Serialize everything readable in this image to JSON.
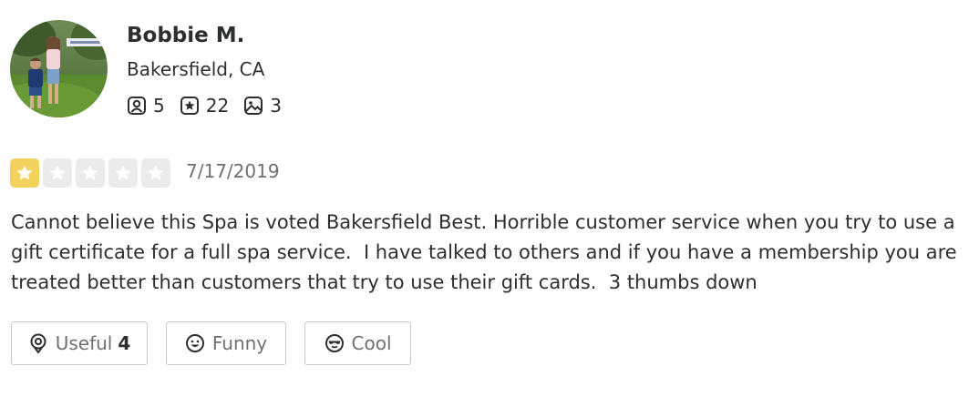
{
  "user": {
    "name": "Bobbie M.",
    "location": "Bakersfield, CA",
    "avatar_icon": "profile-photo",
    "stats": {
      "friends": "5",
      "reviews": "22",
      "photos": "3"
    }
  },
  "review": {
    "rating": 1,
    "rating_max": 5,
    "date": "7/17/2019",
    "text": "Cannot believe this Spa is voted Bakersfield Best. Horrible customer service when you try to use a gift certificate for a full spa service.  I have talked to others and if you have a membership you are treated better than customers that try to use their gift cards.  3 thumbs down"
  },
  "reactions": {
    "useful_label": "Useful",
    "useful_count": "4",
    "funny_label": "Funny",
    "cool_label": "Cool"
  },
  "colors": {
    "star_filled": "#f4d25e",
    "star_empty": "#ebebeb",
    "text": "#2d2e2f",
    "muted": "#6e7072",
    "border": "#c8c9ca"
  }
}
